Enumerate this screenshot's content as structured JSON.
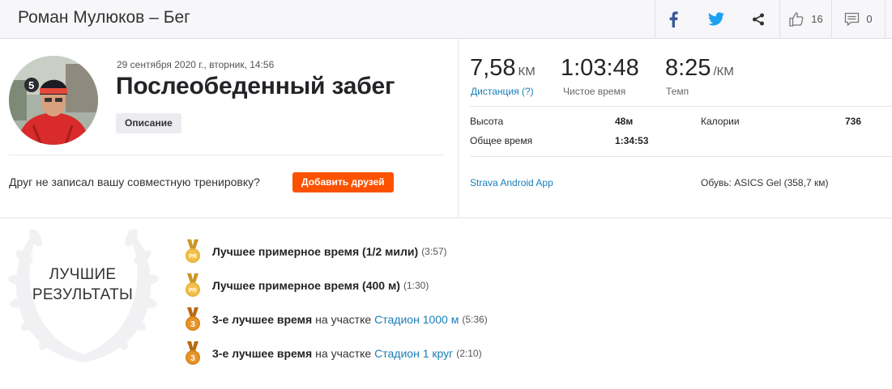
{
  "header": {
    "title": "Роман Мулюков – Бег",
    "kudos_count": "16",
    "comments_count": "0"
  },
  "activity": {
    "date": "29 сентября 2020 г., вторник, 14:56",
    "title": "Послеобеденный забег",
    "description_button": "Описание"
  },
  "friends": {
    "question": "Друг не записал вашу совместную тренировку?",
    "add_button": "Добавить друзей"
  },
  "stats": {
    "distance": {
      "value": "7,58",
      "unit": "КМ",
      "label": "Дистанция (?)"
    },
    "moving_time": {
      "value": "1:03:48",
      "label": "Чистое время"
    },
    "pace": {
      "value": "8:25",
      "unit": "/КМ",
      "label": "Темп"
    },
    "elevation": {
      "label": "Высота",
      "value": "48м"
    },
    "elapsed": {
      "label": "Общее время",
      "value": "1:34:53"
    },
    "calories": {
      "label": "Калории",
      "value": "736"
    }
  },
  "device": "Strava Android App",
  "shoes": "Обувь: ASICS Gel (358,7 км)",
  "achievements": {
    "heading_line1": "ЛУЧШИЕ",
    "heading_line2": "РЕЗУЛЬТАТЫ",
    "items": [
      {
        "medal": "PR",
        "title": "Лучшее примерное время (1/2 мили)",
        "text": "",
        "segment": "",
        "time": "(3:57)"
      },
      {
        "medal": "PR",
        "title": "Лучшее примерное время (400 м)",
        "text": "",
        "segment": "",
        "time": "(1:30)"
      },
      {
        "medal": "3",
        "title": "3-е лучшее время",
        "text": "на участке",
        "segment": "Стадион 1000 м",
        "time": "(5:36)"
      },
      {
        "medal": "3",
        "title": "3-е лучшее время",
        "text": "на участке",
        "segment": "Стадион 1 круг",
        "time": "(2:10)"
      }
    ]
  },
  "icons": {
    "facebook": "facebook-icon",
    "twitter": "twitter-icon",
    "share": "share-icon",
    "kudos": "thumbs-up-icon",
    "comment": "comment-icon",
    "medal_pr": "pr-medal-icon",
    "medal_bronze": "bronze-medal-icon",
    "wreath": "laurel-wreath-icon"
  },
  "colors": {
    "accent": "#fc5200",
    "link": "#1a7eb8",
    "facebook": "#3b5998",
    "twitter": "#1da1f2",
    "medal_gold": "#e8b53a",
    "medal_bronze": "#d9861c"
  }
}
